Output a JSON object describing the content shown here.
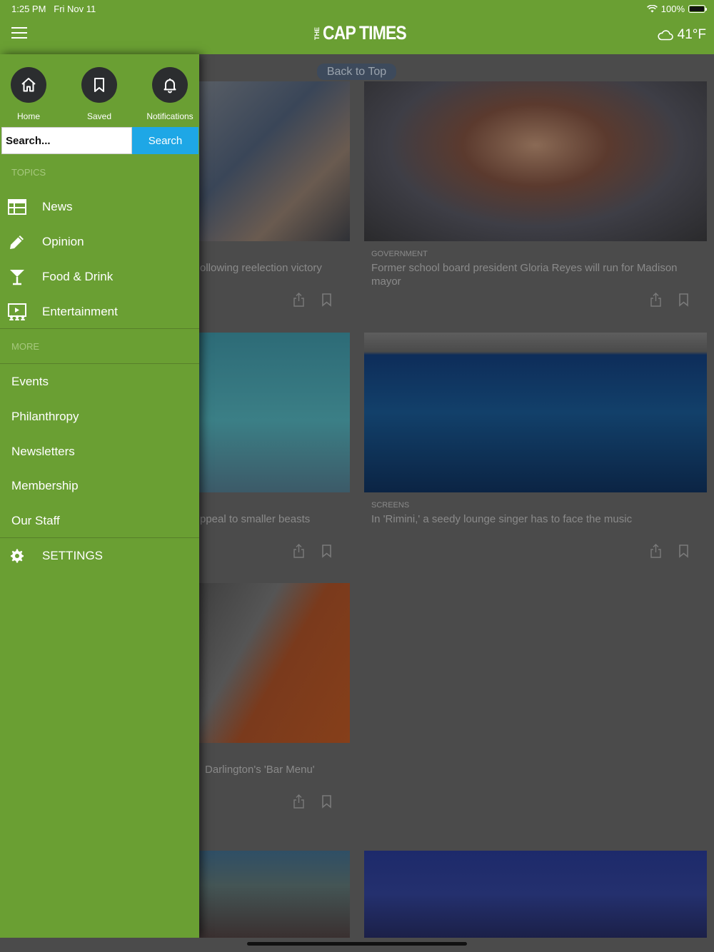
{
  "status": {
    "time": "1:25 PM",
    "date": "Fri Nov 11",
    "battery": "100%",
    "battery_level": 1.0
  },
  "header": {
    "logo_prefix": "THE",
    "logo_main": "CAP TIMES",
    "temperature": "41°F"
  },
  "back_to_top": "Back to Top",
  "drawer": {
    "quick_links": [
      {
        "label": "Home",
        "icon": "home-icon"
      },
      {
        "label": "Saved",
        "icon": "bookmark-icon"
      },
      {
        "label": "Notifications",
        "icon": "bell-icon"
      }
    ],
    "search": {
      "placeholder": "Search...",
      "button": "Search"
    },
    "topics_heading": "TOPICS",
    "topics": [
      {
        "label": "News",
        "icon": "newspaper-icon"
      },
      {
        "label": "Opinion",
        "icon": "pencil-icon"
      },
      {
        "label": "Food & Drink",
        "icon": "cocktail-icon"
      },
      {
        "label": "Entertainment",
        "icon": "presentation-icon"
      }
    ],
    "more_heading": "MORE",
    "more": [
      "Events",
      "Philanthropy",
      "Newsletters",
      "Membership",
      "Our Staff"
    ],
    "settings": "SETTINGS"
  },
  "articles": [
    {
      "kicker": "",
      "title": "ollowing reelection victory"
    },
    {
      "kicker": "GOVERNMENT",
      "title": "Former school board president Gloria Reyes will run for Madison mayor"
    },
    {
      "kicker": "",
      "title": "ppeal to smaller beasts"
    },
    {
      "kicker": "SCREENS",
      "title": "In 'Rimini,' a seedy lounge singer has to face the music"
    },
    {
      "kicker": "",
      "title": "Darlington's 'Bar Menu'"
    }
  ]
}
